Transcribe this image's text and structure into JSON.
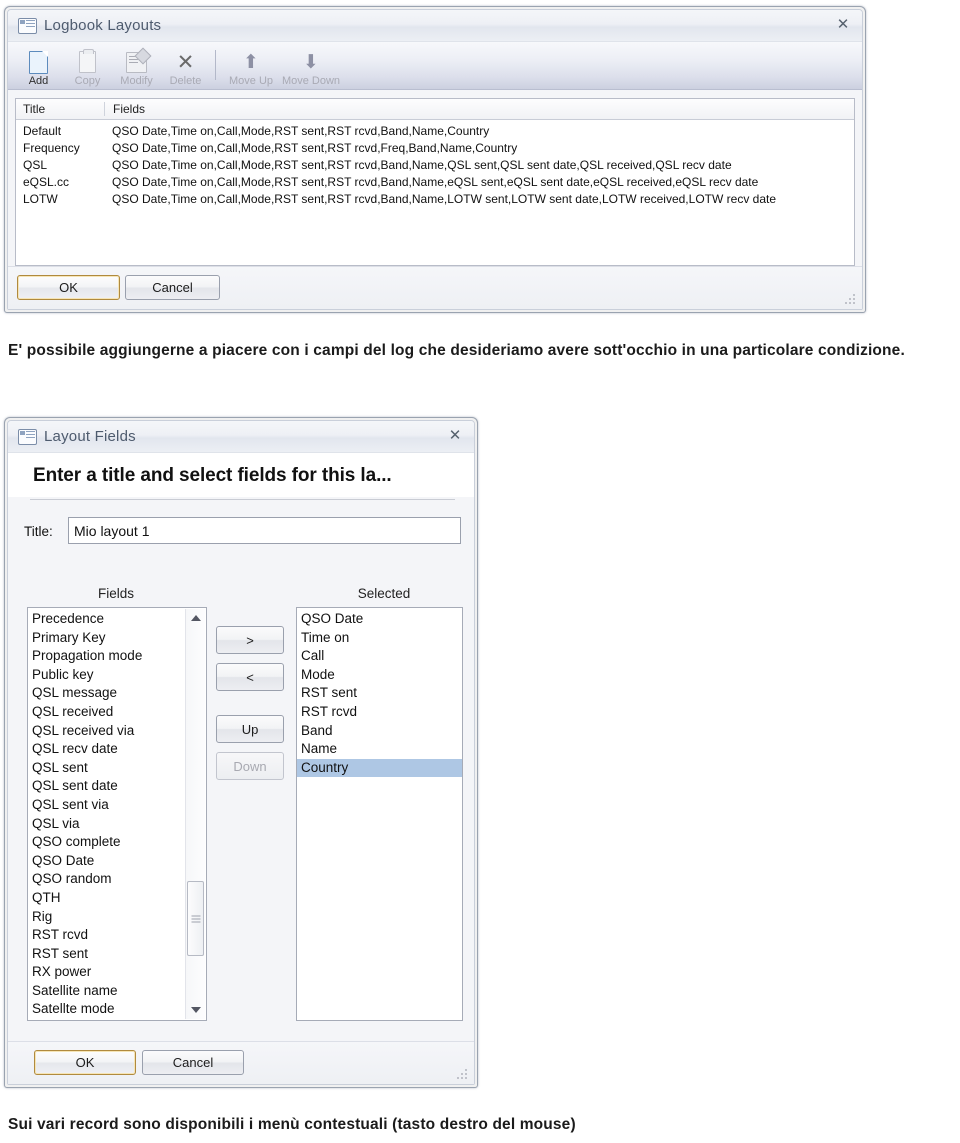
{
  "dialog1": {
    "title": "Logbook Layouts",
    "icon": "window-list-icon",
    "close_label": "✕",
    "toolbar": [
      {
        "label": "Add",
        "icon": "new-document-icon",
        "enabled": true
      },
      {
        "label": "Copy",
        "icon": "copy-icon",
        "enabled": false
      },
      {
        "label": "Modify",
        "icon": "modify-icon",
        "enabled": false
      },
      {
        "label": "Delete",
        "icon": "delete-x-icon",
        "enabled": false
      },
      {
        "label": "Move Up",
        "icon": "arrow-up-icon",
        "enabled": false
      },
      {
        "label": "Move Down",
        "icon": "arrow-down-icon",
        "enabled": false
      }
    ],
    "grid": {
      "columns": [
        "Title",
        "Fields"
      ],
      "rows": [
        {
          "title": "Default",
          "fields": "QSO Date,Time on,Call,Mode,RST sent,RST rcvd,Band,Name,Country"
        },
        {
          "title": "Frequency",
          "fields": "QSO Date,Time on,Call,Mode,RST sent,RST rcvd,Freq,Band,Name,Country"
        },
        {
          "title": "QSL",
          "fields": "QSO Date,Time on,Call,Mode,RST sent,RST rcvd,Band,Name,QSL sent,QSL sent date,QSL received,QSL recv date"
        },
        {
          "title": "eQSL.cc",
          "fields": "QSO Date,Time on,Call,Mode,RST sent,RST rcvd,Band,Name,eQSL sent,eQSL sent date,eQSL received,eQSL recv date"
        },
        {
          "title": "LOTW",
          "fields": "QSO Date,Time on,Call,Mode,RST sent,RST rcvd,Band,Name,LOTW sent,LOTW sent date,LOTW received,LOTW recv date"
        }
      ]
    },
    "ok_label": "OK",
    "cancel_label": "Cancel"
  },
  "paragraph1": "E' possibile aggiungerne a piacere con i campi del log che desideriamo avere sott'occhio in una particolare condizione.",
  "dialog2": {
    "title": "Layout Fields",
    "icon": "window-list-icon",
    "close_label": "✕",
    "heading": "Enter a title and select fields for this la...",
    "title_label": "Title:",
    "title_value": "Mio layout 1",
    "fields_caption": "Fields",
    "selected_caption": "Selected",
    "fields_items": [
      "Precedence",
      "Primary Key",
      "Propagation mode",
      "Public key",
      "QSL message",
      "QSL received",
      "QSL received via",
      "QSL recv date",
      "QSL sent",
      "QSL sent date",
      "QSL sent via",
      "QSL via",
      "QSO complete",
      "QSO Date",
      "QSO random",
      "QTH",
      "Rig",
      "RST rcvd",
      "RST sent",
      "RX power",
      "Satellite name",
      "Satellte mode"
    ],
    "selected_items": [
      "QSO Date",
      "Time on",
      "Call",
      "Mode",
      "RST sent",
      "RST rcvd",
      "Band",
      "Name",
      "Country"
    ],
    "selected_highlight": "Country",
    "transfer_buttons": [
      {
        "label": ">",
        "name": "add-field-button",
        "enabled": true
      },
      {
        "label": "<",
        "name": "remove-field-button",
        "enabled": true
      },
      {
        "label": "Up",
        "name": "move-up-button",
        "enabled": true
      },
      {
        "label": "Down",
        "name": "move-down-button",
        "enabled": false
      }
    ],
    "ok_label": "OK",
    "cancel_label": "Cancel"
  },
  "paragraph2": "Sui vari record sono disponibili i menù contestuali (tasto destro del mouse)"
}
